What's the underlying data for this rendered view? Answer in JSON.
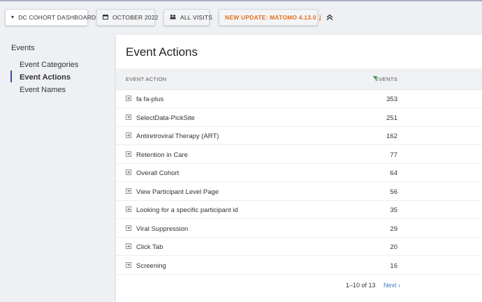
{
  "toolbar": {
    "dashboard_label": "DC COHORT DASHBOARD",
    "date_label": "OCTOBER 2022",
    "segment_label": "ALL VISITS",
    "update_label": "NEW UPDATE: MATOMO 4.13.0",
    "update_color": "#e36f1e"
  },
  "sidebar": {
    "section_title": "Events",
    "items": [
      {
        "label": "Event Categories",
        "active": false
      },
      {
        "label": "Event Actions",
        "active": true
      },
      {
        "label": "Event Names",
        "active": false
      }
    ]
  },
  "report": {
    "title": "Event Actions",
    "columns": {
      "action": "EVENT ACTION",
      "events": "EVENTS"
    },
    "rows": [
      {
        "label": "fa fa-plus",
        "events": "353"
      },
      {
        "label": "SelectData-PickSite",
        "events": "251"
      },
      {
        "label": "Antiretroviral Therapy (ART)",
        "events": "162"
      },
      {
        "label": "Retention in Care",
        "events": "77"
      },
      {
        "label": "Overall Cohort",
        "events": "64"
      },
      {
        "label": "View Participant Level Page",
        "events": "56"
      },
      {
        "label": "Looking for a specific participant id",
        "events": "35"
      },
      {
        "label": "Viral Suppression",
        "events": "29"
      },
      {
        "label": "Click Tab",
        "events": "20"
      },
      {
        "label": "Screening",
        "events": "16"
      }
    ],
    "pagination": {
      "info": "1–10 of 13",
      "next_label": "Next ›"
    }
  },
  "colors": {
    "accent": "#3450a3",
    "sort_arrow": "#43a047",
    "link": "#3a7bbf"
  }
}
